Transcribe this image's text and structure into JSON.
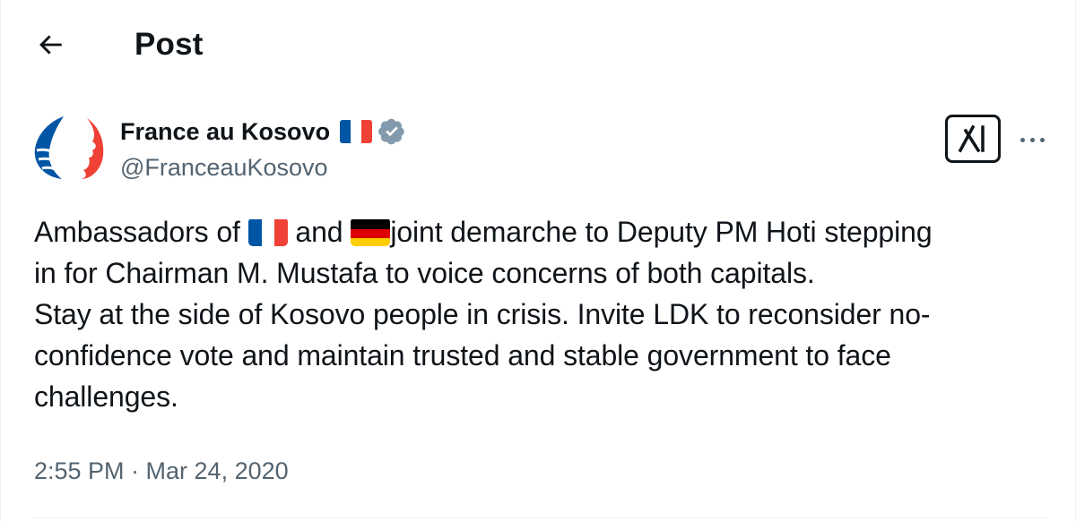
{
  "header": {
    "title": "Post",
    "back_icon": "arrow-left-icon"
  },
  "author": {
    "display_name": "France au Kosovo",
    "handle": "@FranceauKosovo",
    "name_flag": "flag-france-icon",
    "verified_icon": "verified-badge-icon",
    "avatar_icon": "marianne-logo-icon"
  },
  "actions": {
    "grok_icon": "grok-icon",
    "more_icon": "more-horizontal-icon"
  },
  "tweet": {
    "seg_1": "Ambassadors of ",
    "seg_2": " and ",
    "seg_3": "joint demarche to Deputy PM Hoti stepping",
    "line_2": "in for Chairman M. Mustafa to voice concerns of both capitals.",
    "line_3": "Stay at the side of Kosovo people in crisis. Invite LDK to reconsider no-",
    "line_4": "confidence vote and maintain trusted and stable government to face",
    "line_5": "challenges.",
    "flag_1": "flag-france-icon",
    "flag_2": "flag-germany-icon"
  },
  "timestamp": "2:55 PM · Mar 24, 2020",
  "colors": {
    "text_primary": "#0f1419",
    "text_secondary": "#536471",
    "verified_gray": "#829aab",
    "france_blue": "#0055a4",
    "france_red": "#ef4135",
    "germany_black": "#000000",
    "germany_red": "#dd0000",
    "germany_gold": "#ffce00",
    "divider": "#eff3f4"
  }
}
